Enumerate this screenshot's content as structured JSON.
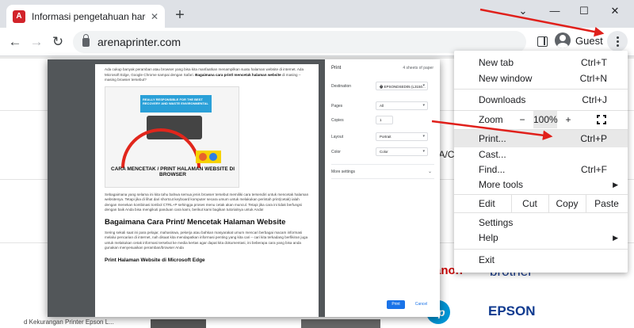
{
  "browser": {
    "tab_title": "Informasi pengetahuan harga sp...",
    "new_tab_symbol": "+",
    "url": "arenaprinter.com",
    "profile_label": "Guest",
    "window_controls": {
      "chevron": "⌄",
      "minimize": "—",
      "maximize": "☐",
      "close": "✕"
    }
  },
  "menu": {
    "items": {
      "new_tab": {
        "label": "New tab",
        "shortcut": "Ctrl+T"
      },
      "new_window": {
        "label": "New window",
        "shortcut": "Ctrl+N"
      },
      "downloads": {
        "label": "Downloads",
        "shortcut": "Ctrl+J"
      },
      "print": {
        "label": "Print...",
        "shortcut": "Ctrl+P"
      },
      "cast": {
        "label": "Cast..."
      },
      "find": {
        "label": "Find...",
        "shortcut": "Ctrl+F"
      },
      "more_tools": {
        "label": "More tools"
      },
      "settings": {
        "label": "Settings"
      },
      "help": {
        "label": "Help"
      },
      "exit": {
        "label": "Exit"
      }
    },
    "zoom": {
      "label": "Zoom",
      "minus": "−",
      "value": "100%",
      "plus": "+"
    },
    "edit": {
      "label": "Edit",
      "cut": "Cut",
      "copy": "Copy",
      "paste": "Paste"
    }
  },
  "print_dialog": {
    "title": "Print",
    "sheets": "4 sheets of paper",
    "destination": {
      "label": "Destination",
      "value": "EPSONDSED05 (L3150..."
    },
    "pages": {
      "label": "Pages",
      "value": "All"
    },
    "copies": {
      "label": "Copies",
      "value": "1"
    },
    "layout": {
      "label": "Layout",
      "value": "Portrait"
    },
    "color": {
      "label": "Color",
      "value": "Color"
    },
    "more_settings": "More settings",
    "print_button": "Print",
    "cancel_button": "Cancel"
  },
  "preview": {
    "intro": "Ada cukup banyak peramban atau browser yang bisa kita manfaatkan menampilkan suatu halaman website di internet. Ada Microsoft Edge, Google Chrome sampai dengan Safari.",
    "intro_bold": "Bagaimana cara print/ mencetak halaman website",
    "intro_tail": "di masing – masing browser tersebut?",
    "thumb_banner": "REALLY RESPONSIBLE FOR THE BEST RECOVERY AND WASTE ENVIRONMENTAL",
    "thumb_caption": "CARA MENCETAK / PRINT HALAMAN WEBSITE DI BROWSER",
    "para1": "Sebagaimana yang selama ini kita tahu bahwa semua jenis browser tersebut memiliki cara tersendiri untuk mencetak halaman websitenya. Tetapi jika di lihat dari shortcut keyboard komputer secara umum untuk melakukan perintah print(cetak) ialah dengan menekan kombinasi tombol CTRL+P sehingga proses menu cetak akan muncul. Tetapi jika cara ini tidak berfungsi dengan baik Anda bisa mengikuti panduan cara kami, berikut kami bagikan tutorialnya untuk Anda!",
    "heading": "Bagaimana Cara Print/ Mencetak Halaman Website",
    "para2": "Sering sekali saat ini para pelajar, mahasiswa, pekerja atau bahkan masyarakat umum mencari berbagai macam informasi melalui pencarian di internet, nah disaat kita mendapatkan informasi penting yang kita cari – cari kita terkadang berfikiran juga untuk melakukan cetak informasi tersebut ke media kertas agar dapat kita dokumentasi, ini beberapa cara yang bisa anda gunakan menyesuaikan peramban/browser Anda",
    "subheading": "Print Halaman Website di Microsoft Edge"
  },
  "background": {
    "partial_text": "TA/CA",
    "caption_text": "d Kekurangan Printer Epson L..."
  },
  "brands": {
    "canon": "anon",
    "brother": "brother",
    "epson": "EPSON"
  },
  "colors": {
    "tabstrip": "#dee1e6",
    "accent_blue": "#1a73e8",
    "annotation_red": "#e0201b",
    "brand_canon": "#cc0000",
    "brand_brother": "#1a3c8c",
    "brand_epson": "#0f3a8f",
    "brand_hp": "#0096d6"
  }
}
